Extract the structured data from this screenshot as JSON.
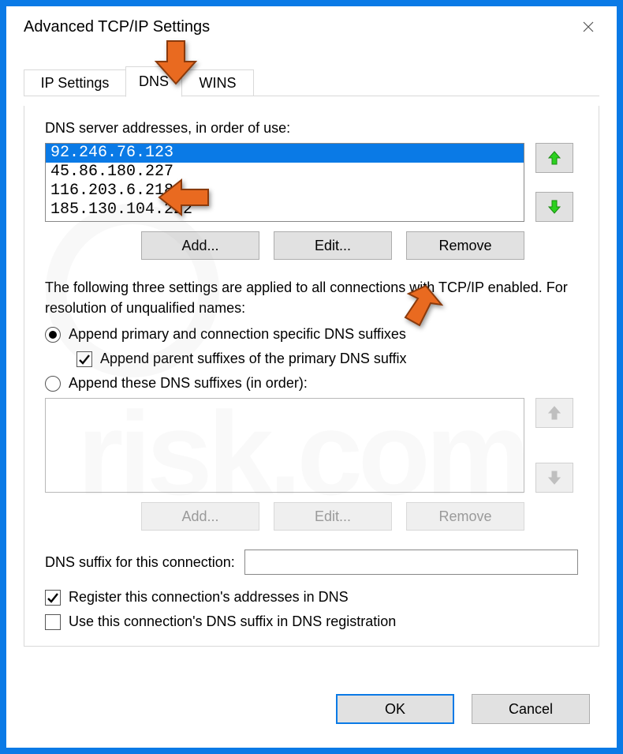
{
  "window": {
    "title": "Advanced TCP/IP Settings"
  },
  "tabs": {
    "ip": "IP Settings",
    "dns": "DNS",
    "wins": "WINS",
    "active": "dns"
  },
  "dns": {
    "servers_label": "DNS server addresses, in order of use:",
    "servers": [
      "92.246.76.123",
      "45.86.180.227",
      "116.203.6.218",
      "185.130.104.222"
    ],
    "selected_index": 0,
    "add": "Add...",
    "edit": "Edit...",
    "remove": "Remove"
  },
  "resolution_text": "The following three settings are applied to all connections with TCP/IP enabled. For resolution of unqualified names:",
  "options": {
    "append_primary": {
      "label": "Append primary and connection specific DNS suffixes",
      "checked": true
    },
    "append_parent": {
      "label": "Append parent suffixes of the primary DNS suffix",
      "checked": true
    },
    "append_these": {
      "label": "Append these DNS suffixes (in order):",
      "checked": false
    }
  },
  "suffix_buttons": {
    "add": "Add...",
    "edit": "Edit...",
    "remove": "Remove"
  },
  "suffix_field": {
    "label": "DNS suffix for this connection:",
    "value": ""
  },
  "checkboxes": {
    "register": {
      "label": "Register this connection's addresses in DNS",
      "checked": true
    },
    "use_suffix_reg": {
      "label": "Use this connection's DNS suffix in DNS registration",
      "checked": false
    }
  },
  "dialog_buttons": {
    "ok": "OK",
    "cancel": "Cancel"
  },
  "annotations": {
    "arrow_color": "#e96a20"
  }
}
